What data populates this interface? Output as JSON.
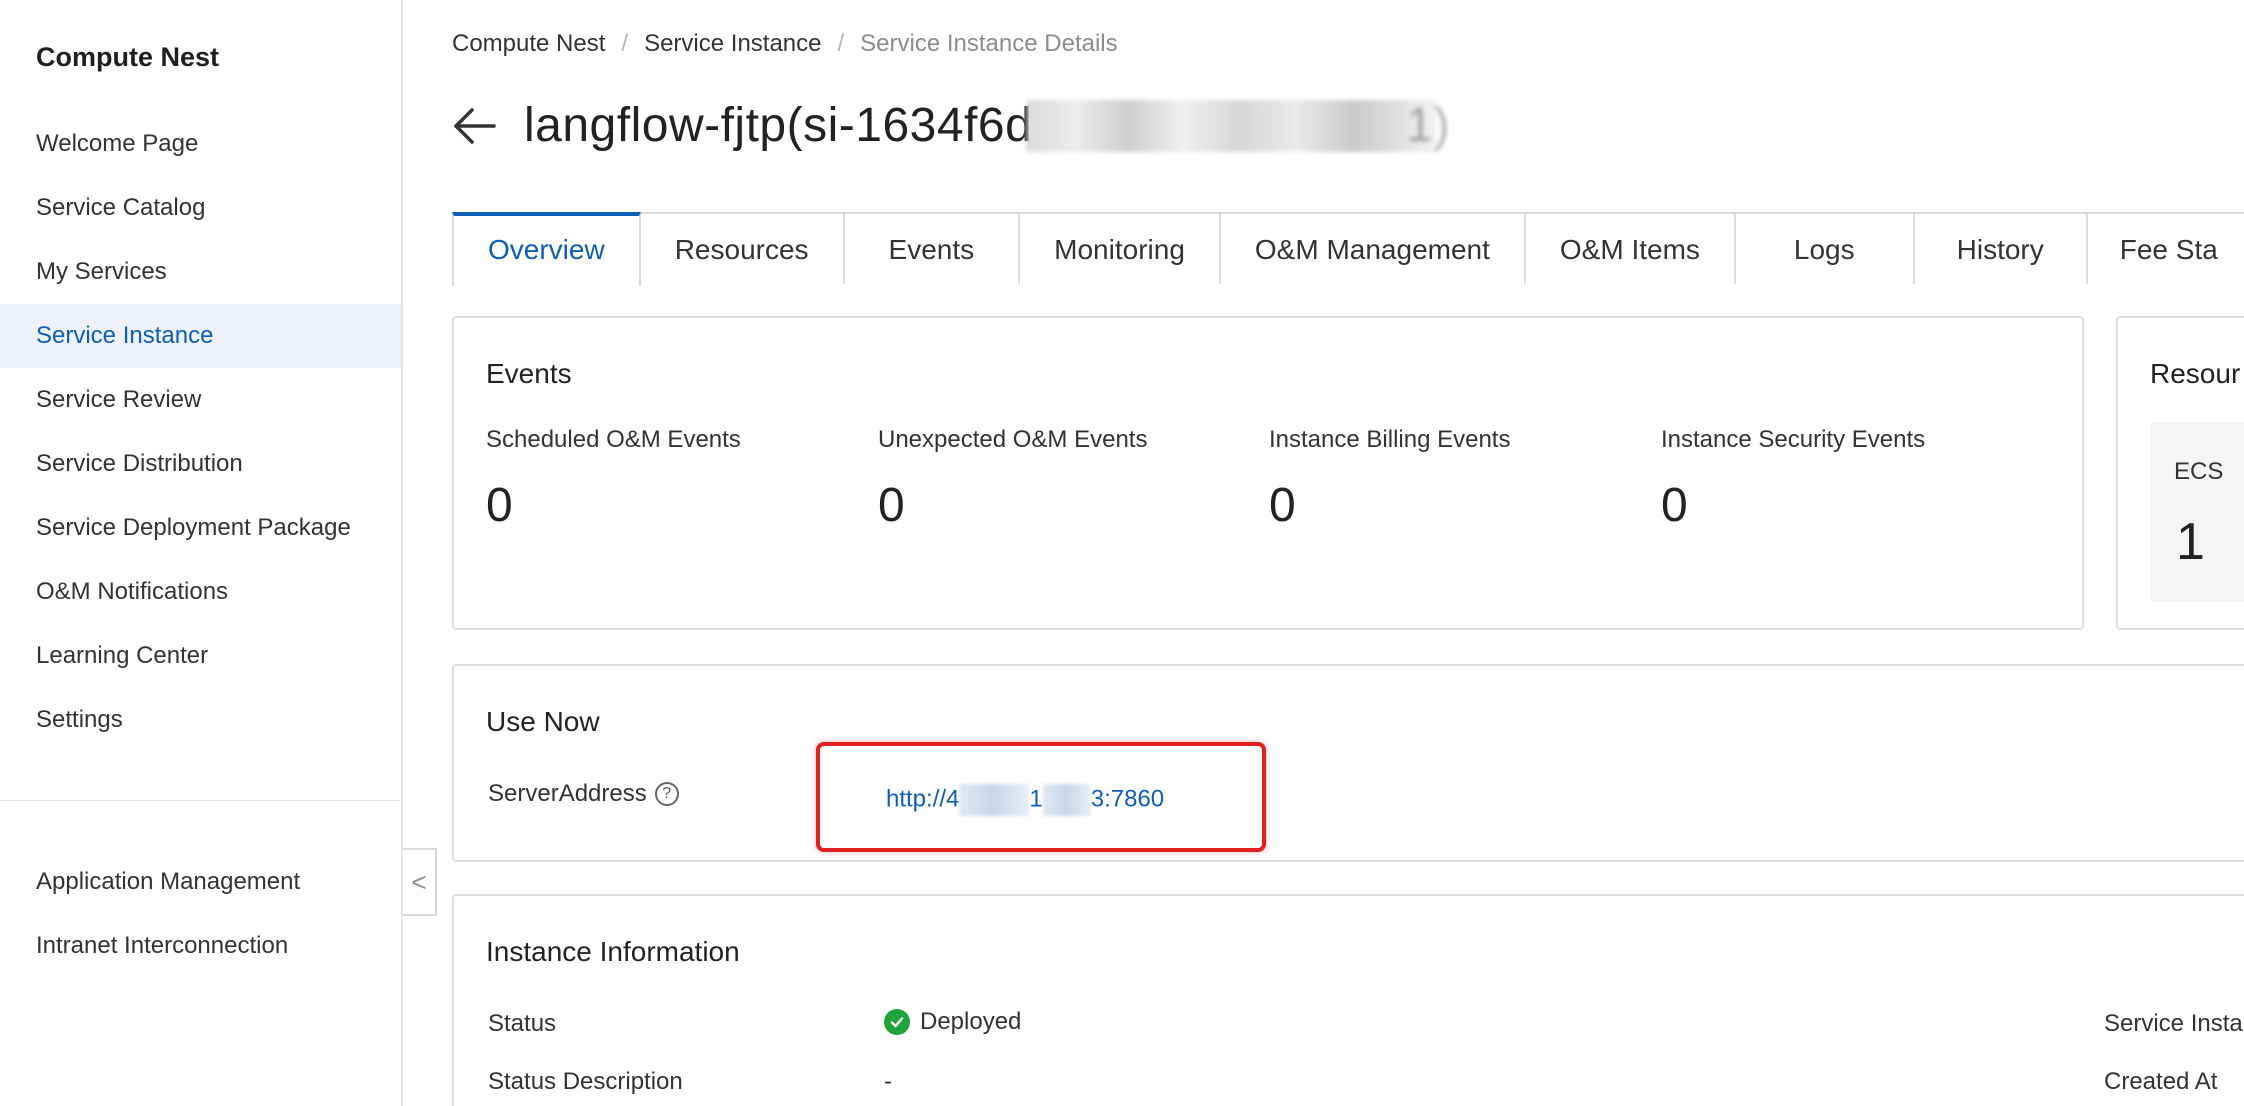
{
  "sidebar": {
    "title": "Compute Nest",
    "items": [
      {
        "label": "Welcome Page"
      },
      {
        "label": "Service Catalog"
      },
      {
        "label": "My Services"
      },
      {
        "label": "Service Instance",
        "active": true
      },
      {
        "label": "Service Review"
      },
      {
        "label": "Service Distribution"
      },
      {
        "label": "Service Deployment Package"
      },
      {
        "label": "O&M Notifications"
      },
      {
        "label": "Learning Center"
      },
      {
        "label": "Settings"
      }
    ],
    "bottom_items": [
      {
        "label": "Application Management"
      },
      {
        "label": "Intranet Interconnection"
      }
    ],
    "collapse_glyph": "<"
  },
  "breadcrumb": {
    "items": [
      "Compute Nest",
      "Service Instance",
      "Service Instance Details"
    ],
    "separator": "/"
  },
  "header": {
    "title_visible": "langflow-fjtp(si-1634f6d",
    "title_tail": "1)"
  },
  "tabs": [
    {
      "label": "Overview",
      "active": true
    },
    {
      "label": "Resources"
    },
    {
      "label": "Events"
    },
    {
      "label": "Monitoring"
    },
    {
      "label": "O&M Management"
    },
    {
      "label": "O&M Items"
    },
    {
      "label": "Logs"
    },
    {
      "label": "History"
    },
    {
      "label": "Fee Sta"
    }
  ],
  "events_card": {
    "title": "Events",
    "stats": [
      {
        "label": "Scheduled O&M Events",
        "value": "0"
      },
      {
        "label": "Unexpected O&M Events",
        "value": "0"
      },
      {
        "label": "Instance Billing Events",
        "value": "0"
      },
      {
        "label": "Instance Security Events",
        "value": "0"
      }
    ]
  },
  "resources_card": {
    "title": "Resour",
    "ecs_label": "ECS",
    "ecs_value": "1"
  },
  "use_now": {
    "title": "Use Now",
    "field_label": "ServerAddress",
    "help_glyph": "?",
    "link_prefix": "http://4",
    "link_middle": "1",
    "link_suffix": "3:7860"
  },
  "instance_info": {
    "title": "Instance Information",
    "status_label": "Status",
    "status_value": "Deployed",
    "status_desc_label": "Status Description",
    "status_desc_value": "-",
    "right_label_1": "Service Insta",
    "right_label_2": "Created At"
  },
  "colors": {
    "accent": "#0b5fb8",
    "highlight": "#e11f1f",
    "success": "#1fa33a"
  }
}
